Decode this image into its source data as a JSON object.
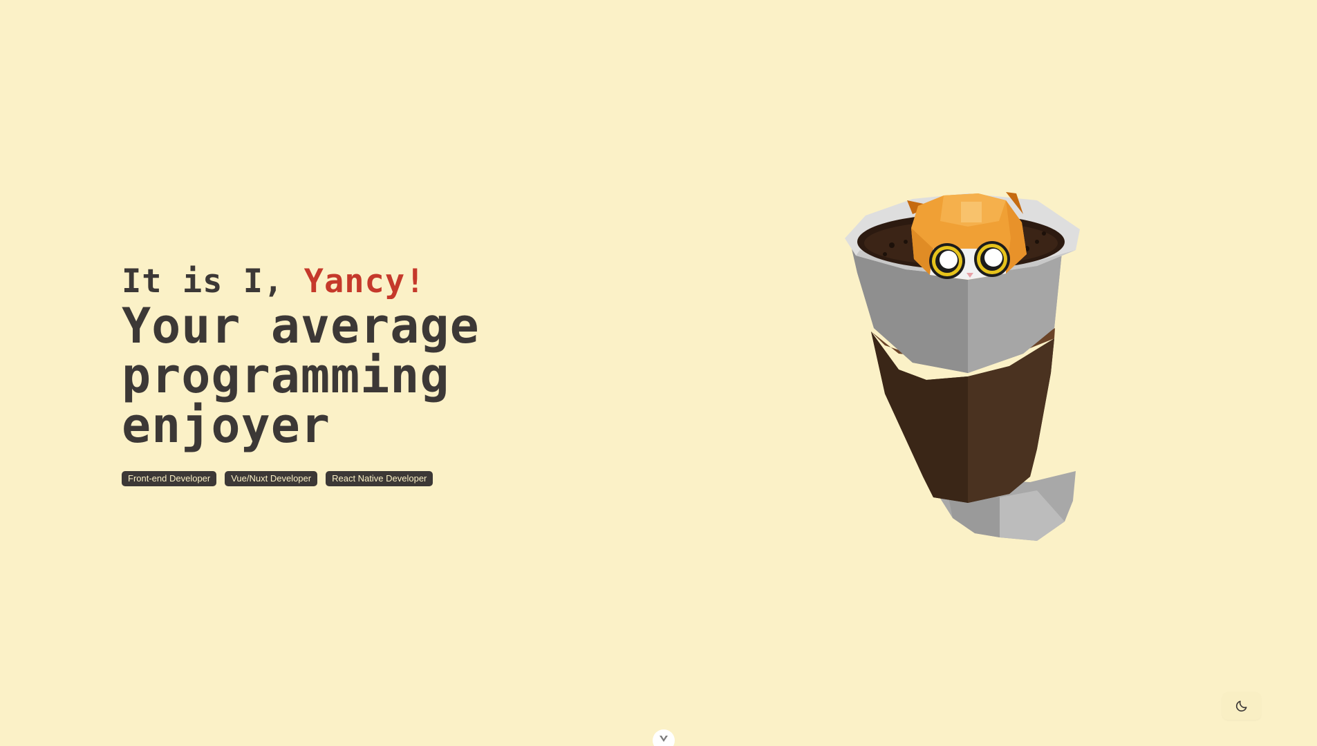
{
  "hero": {
    "greeting_prefix": "It is I, ",
    "name": "Yancy!",
    "headline_lines": [
      "Your average",
      "programming",
      "enjoyer"
    ],
    "tags": [
      "Front-end Developer",
      "Vue/Nuxt Developer",
      "React Native Developer"
    ]
  },
  "icons": {
    "theme_toggle": "moon-icon",
    "scroll": "chevron-down-icon"
  },
  "colors": {
    "background": "#fbf1c7",
    "text": "#3c3836",
    "accent": "#c5392b"
  }
}
